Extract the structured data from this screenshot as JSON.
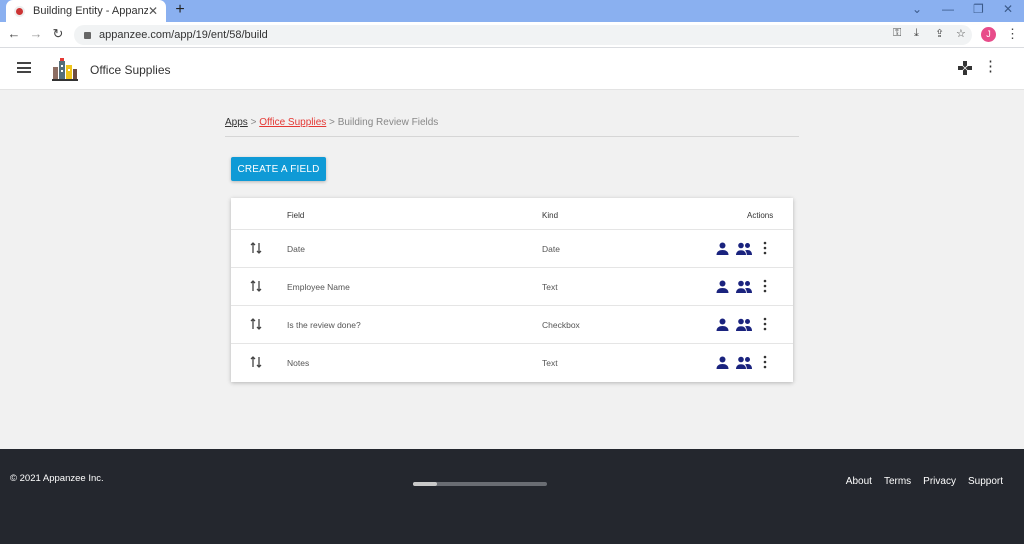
{
  "browser": {
    "tab_title": "Building Entity - Appanzee",
    "tab_close": "✕",
    "new_tab": "+",
    "url": "appanzee.com/app/19/ent/58/build",
    "profile_initial": "J"
  },
  "header": {
    "app_name": "Office Supplies"
  },
  "breadcrumb": {
    "apps": "Apps",
    "sep1": " > ",
    "app": "Office Supplies",
    "sep2": " > ",
    "current": "Building Review Fields"
  },
  "create_button": "CREATE A FIELD",
  "table": {
    "columns": {
      "field": "Field",
      "kind": "Kind",
      "actions": "Actions"
    },
    "rows": [
      {
        "field": "Date",
        "kind": "Date"
      },
      {
        "field": "Employee Name",
        "kind": "Text"
      },
      {
        "field": "Is the review done?",
        "kind": "Checkbox"
      },
      {
        "field": "Notes",
        "kind": "Text"
      }
    ]
  },
  "footer": {
    "copyright": "© 2021 Appanzee Inc.",
    "links": [
      "About",
      "Terms",
      "Privacy",
      "Support"
    ]
  },
  "colors": {
    "primary": "#0f9ad6",
    "breadcrumb_link": "#e53935",
    "icon_navy": "#1a237e",
    "footer_bg": "#24272e"
  }
}
